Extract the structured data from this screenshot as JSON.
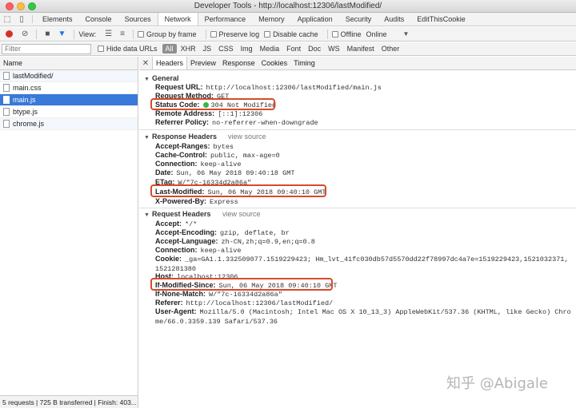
{
  "window": {
    "title": "Developer Tools - http://localhost:12306/lastModified/"
  },
  "panel_tabs": [
    {
      "label": "Elements"
    },
    {
      "label": "Console"
    },
    {
      "label": "Sources"
    },
    {
      "label": "Network"
    },
    {
      "label": "Performance"
    },
    {
      "label": "Memory"
    },
    {
      "label": "Application"
    },
    {
      "label": "Security"
    },
    {
      "label": "Audits"
    },
    {
      "label": "EditThisCookie"
    }
  ],
  "toolbar": {
    "view_label": "View:",
    "group_by_frame": "Group by frame",
    "preserve_log": "Preserve log",
    "disable_cache": "Disable cache",
    "offline": "Offline",
    "throttle": "Online"
  },
  "filter": {
    "placeholder": "Filter",
    "hide_data_urls": "Hide data URLs",
    "types": [
      "All",
      "XHR",
      "JS",
      "CSS",
      "Img",
      "Media",
      "Font",
      "Doc",
      "WS",
      "Manifest",
      "Other"
    ]
  },
  "request_list": {
    "header": "Name",
    "items": [
      {
        "name": "lastModified/"
      },
      {
        "name": "main.css"
      },
      {
        "name": "main.js"
      },
      {
        "name": "btype.js"
      },
      {
        "name": "chrome.js"
      }
    ],
    "status": "5 requests | 725 B transferred | Finish: 403..."
  },
  "detail_tabs": [
    {
      "label": "Headers"
    },
    {
      "label": "Preview"
    },
    {
      "label": "Response"
    },
    {
      "label": "Cookies"
    },
    {
      "label": "Timing"
    }
  ],
  "general": {
    "title": "General",
    "rows": [
      {
        "k": "Request URL:",
        "v": "http://localhost:12306/lastModified/main.js"
      },
      {
        "k": "Request Method:",
        "v": "GET"
      },
      {
        "k": "Status Code:",
        "v": "304 Not Modified"
      },
      {
        "k": "Remote Address:",
        "v": "[::1]:12306"
      },
      {
        "k": "Referrer Policy:",
        "v": "no-referrer-when-downgrade"
      }
    ]
  },
  "response_headers": {
    "title": "Response Headers",
    "view_source": "view source",
    "rows": [
      {
        "k": "Accept-Ranges:",
        "v": "bytes"
      },
      {
        "k": "Cache-Control:",
        "v": "public, max-age=0"
      },
      {
        "k": "Connection:",
        "v": "keep-alive"
      },
      {
        "k": "Date:",
        "v": "Sun, 06 May 2018 09:40:18 GMT"
      },
      {
        "k": "ETag:",
        "v": "W/\"7c-16334d2a86a\""
      },
      {
        "k": "Last-Modified:",
        "v": "Sun, 06 May 2018 09:40:10 GMT"
      },
      {
        "k": "X-Powered-By:",
        "v": "Express"
      }
    ]
  },
  "request_headers": {
    "title": "Request Headers",
    "view_source": "view source",
    "rows": [
      {
        "k": "Accept:",
        "v": "*/*"
      },
      {
        "k": "Accept-Encoding:",
        "v": "gzip, deflate, br"
      },
      {
        "k": "Accept-Language:",
        "v": "zh-CN,zh;q=0.9,en;q=0.8"
      },
      {
        "k": "Connection:",
        "v": "keep-alive"
      },
      {
        "k": "Cookie:",
        "v": "_ga=GA1.1.332509077.1519229423; Hm_lvt_41fc030db57d5570dd22f78997dc4a7e=1519229423,1521032371,1521281380"
      },
      {
        "k": "Host:",
        "v": "localhost:12306"
      },
      {
        "k": "If-Modified-Since:",
        "v": "Sun, 06 May 2018 09:40:10 GMT"
      },
      {
        "k": "If-None-Match:",
        "v": "W/\"7c-16334d2a86a\""
      },
      {
        "k": "Referer:",
        "v": "http://localhost:12306/lastModified/"
      },
      {
        "k": "User-Agent:",
        "v": "Mozilla/5.0 (Macintosh; Intel Mac OS X 10_13_3) AppleWebKit/537.36 (KHTML, like Gecko) Chrome/66.0.3359.139 Safari/537.36"
      }
    ]
  },
  "watermark": "知乎 @Abigale",
  "colors": {
    "highlight": "#d84a28",
    "selected_row": "#3879d9",
    "status_ok": "#2fb94a",
    "record": "#d93025"
  }
}
